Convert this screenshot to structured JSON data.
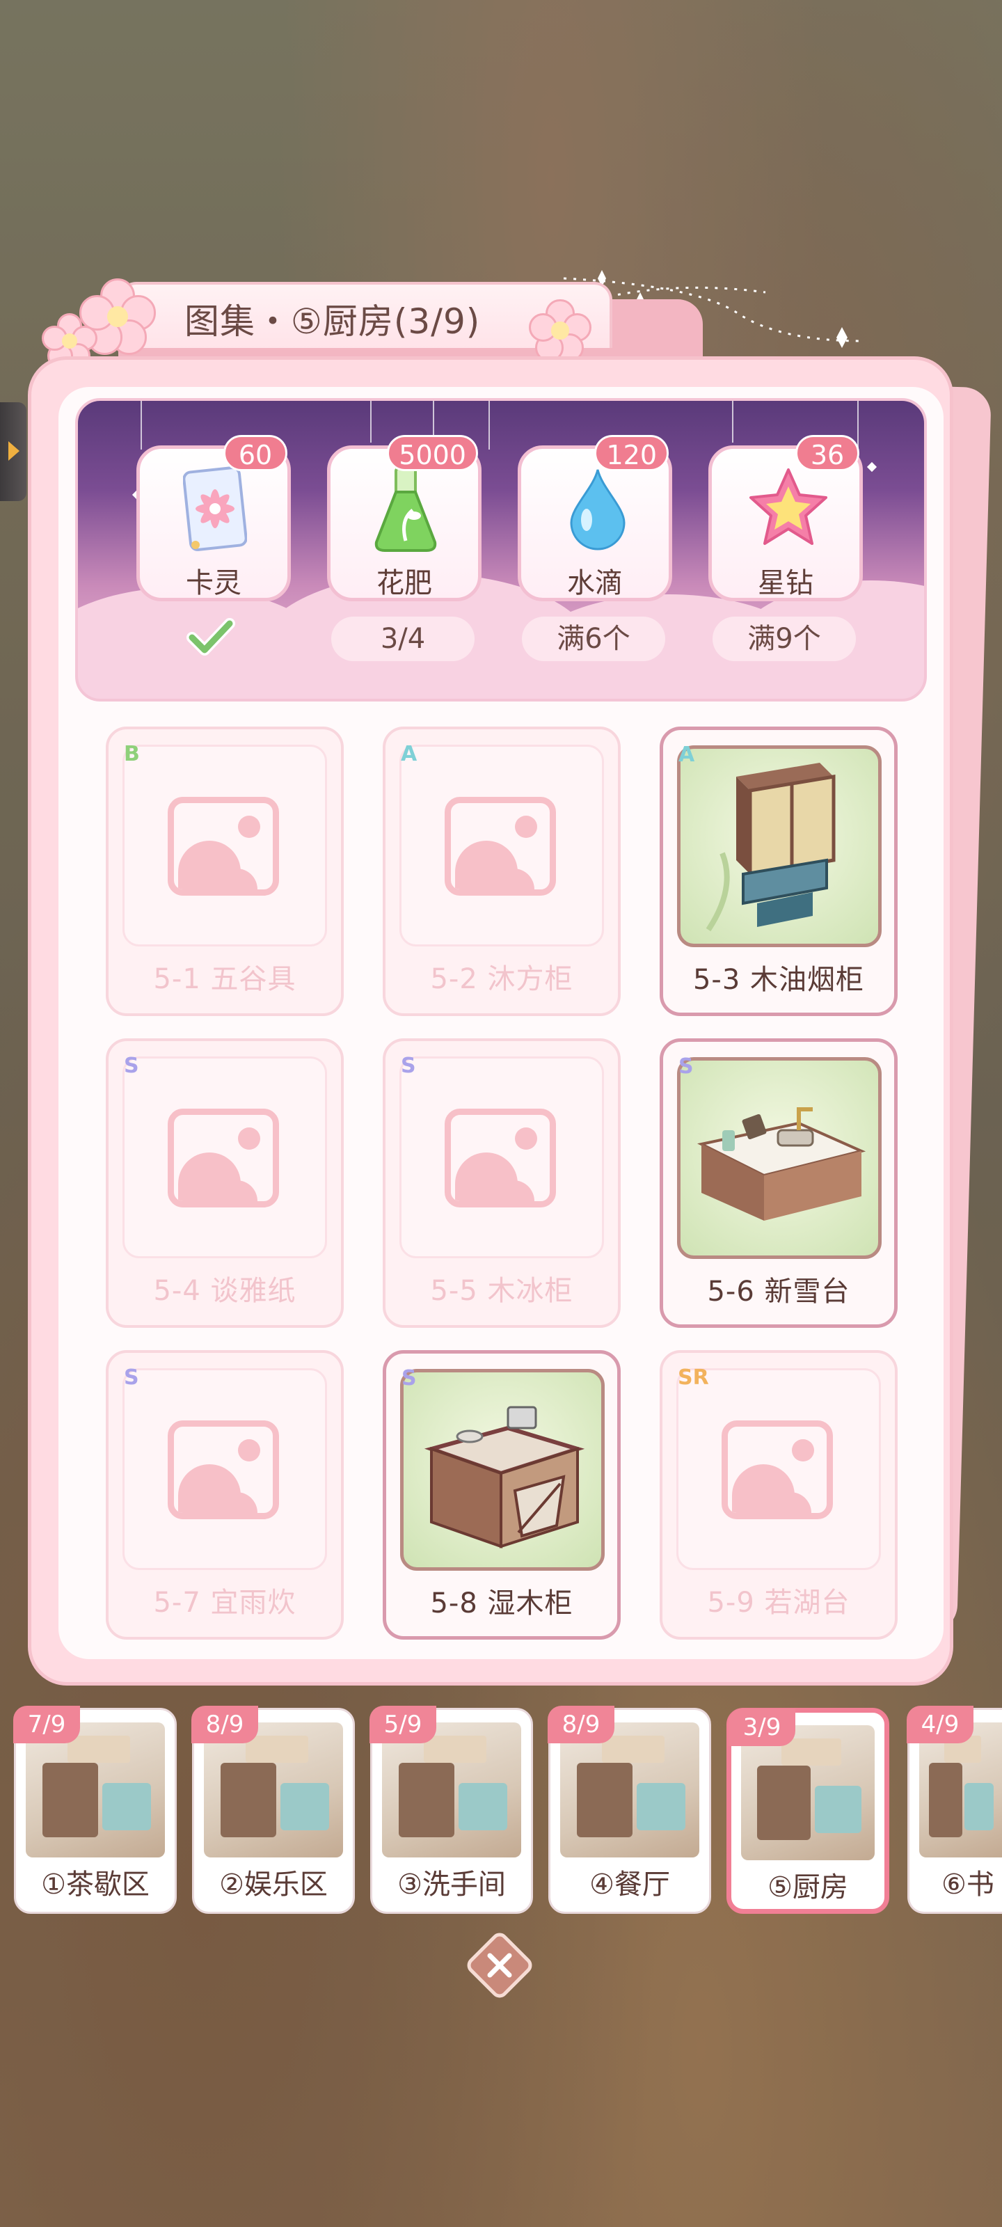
{
  "title": "图集・⑤厨房(3/9)",
  "rewards": [
    {
      "name": "卡灵",
      "count": "60",
      "requirement": "",
      "claimed": true,
      "icon": "card-icon"
    },
    {
      "name": "花肥",
      "count": "5000",
      "requirement": "3/4",
      "claimed": false,
      "icon": "fertilizer-flask-icon"
    },
    {
      "name": "水滴",
      "count": "120",
      "requirement": "满6个",
      "claimed": false,
      "icon": "water-drop-icon"
    },
    {
      "name": "星钻",
      "count": "36",
      "requirement": "满9个",
      "claimed": false,
      "icon": "star-diamond-icon"
    }
  ],
  "items": [
    {
      "label": "5-1 五谷具",
      "rank": "B",
      "owned": false
    },
    {
      "label": "5-2 沐方柜",
      "rank": "A",
      "owned": false
    },
    {
      "label": "5-3 木油烟柜",
      "rank": "A",
      "owned": true
    },
    {
      "label": "5-4 谈雅纸",
      "rank": "S",
      "owned": false
    },
    {
      "label": "5-5 木冰柜",
      "rank": "S",
      "owned": false
    },
    {
      "label": "5-6 新雪台",
      "rank": "S",
      "owned": true
    },
    {
      "label": "5-7 宜雨炊",
      "rank": "S",
      "owned": false
    },
    {
      "label": "5-8 湿木柜",
      "rank": "S",
      "owned": true
    },
    {
      "label": "5-9 若湖台",
      "rank": "SR",
      "owned": false
    }
  ],
  "rank_colors": {
    "B": "#8fd07a",
    "A": "#7fd0d6",
    "S": "#a9a2ea",
    "SR": "#f2b25c"
  },
  "rooms": [
    {
      "name": "①茶歇区",
      "progress": "7/9",
      "active": false
    },
    {
      "name": "②娱乐区",
      "progress": "8/9",
      "active": false
    },
    {
      "name": "③洗手间",
      "progress": "5/9",
      "active": false
    },
    {
      "name": "④餐厅",
      "progress": "8/9",
      "active": false
    },
    {
      "name": "⑤厨房",
      "progress": "3/9",
      "active": true
    },
    {
      "name": "⑥书",
      "progress": "4/9",
      "active": false
    }
  ],
  "close_icon": "close-icon"
}
